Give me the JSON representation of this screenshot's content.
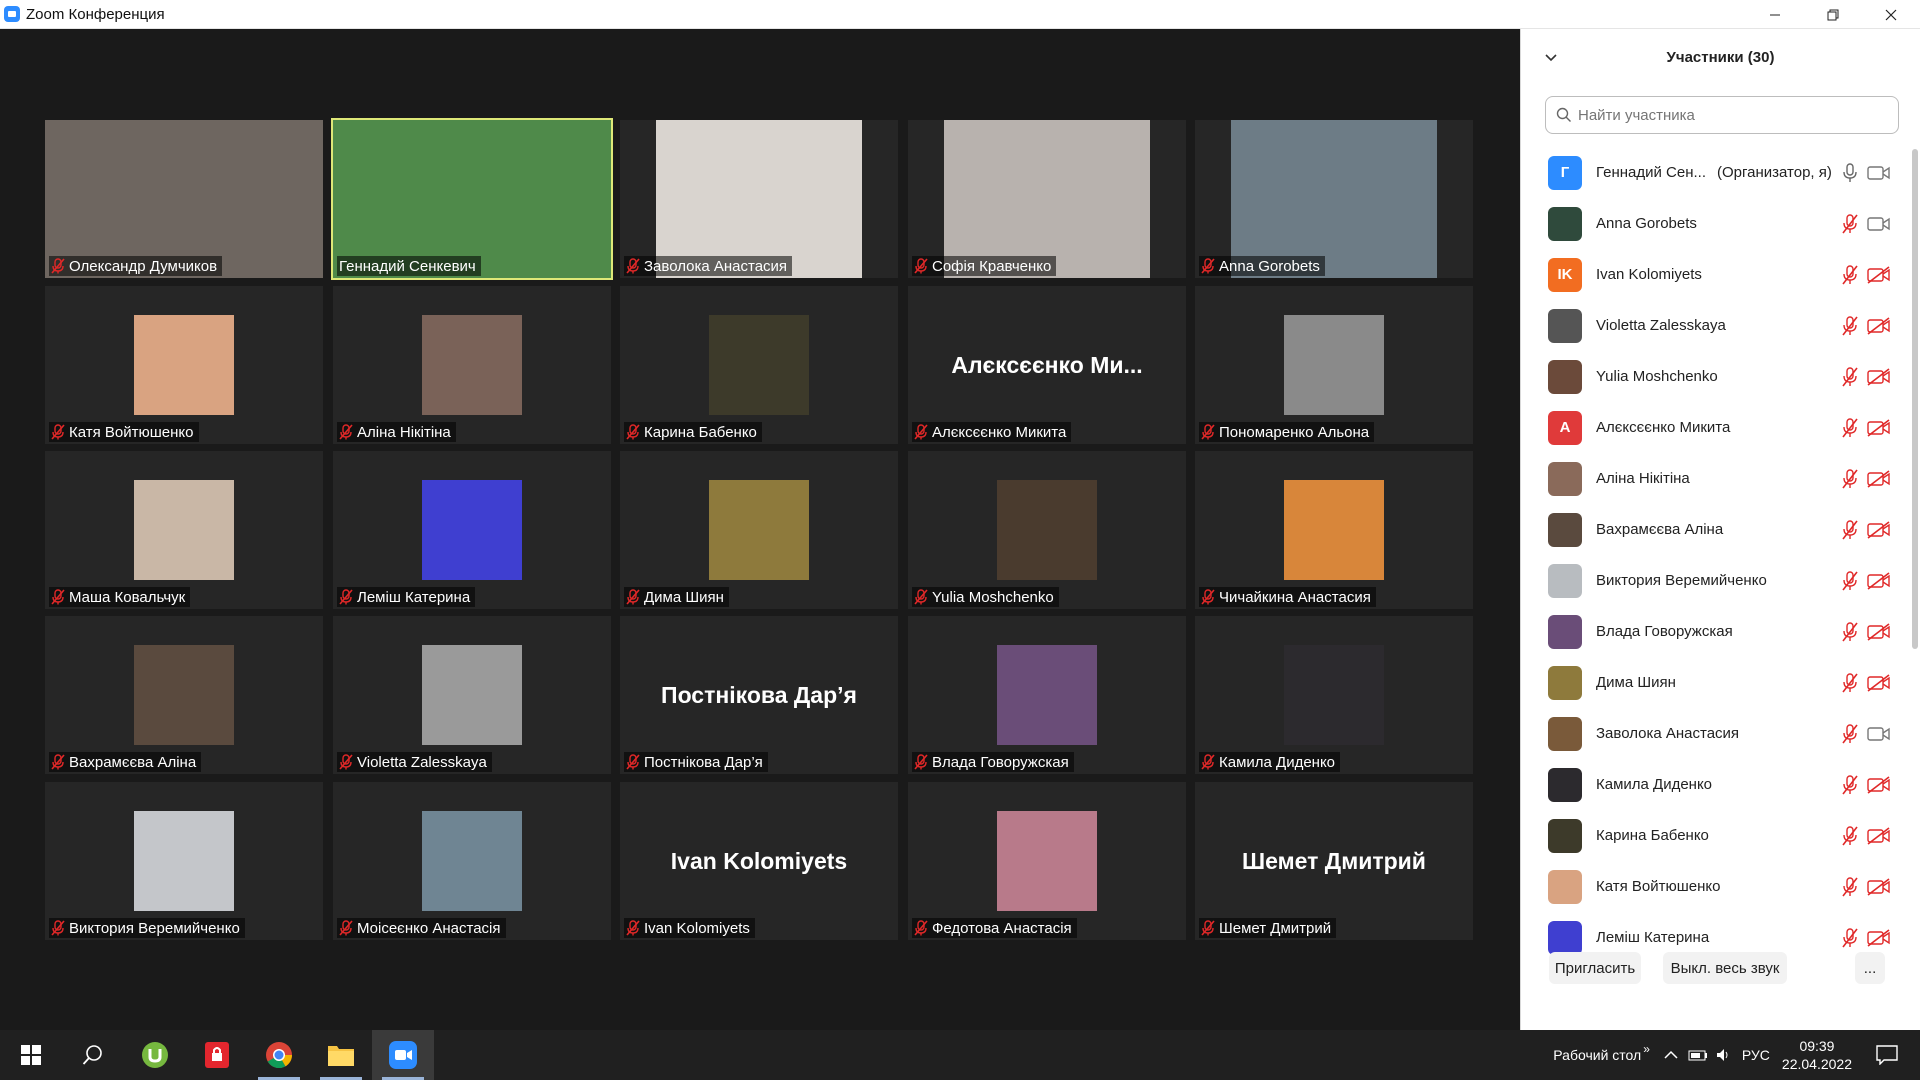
{
  "window": {
    "title": "Zoom Конференция"
  },
  "tiles": [
    {
      "name": "Олександр Думчиков",
      "kind": "cam",
      "bg": "#6e6660",
      "muted": true
    },
    {
      "name": "Геннадий Сенкевич",
      "kind": "cam",
      "bg": "#4f8a4a",
      "muted": false,
      "active": true
    },
    {
      "name": "Заволока Анастасия",
      "kind": "cam",
      "bg": "#d9d4cf",
      "muted": true
    },
    {
      "name": "Софія Кравченко",
      "kind": "cam",
      "bg": "#b8b2ae",
      "muted": true
    },
    {
      "name": "Anna Gorobets",
      "kind": "cam",
      "bg": "#6d7c86",
      "muted": true
    },
    {
      "name": "Катя Войтюшенко",
      "kind": "avatar",
      "bg": "#d9a381",
      "muted": true
    },
    {
      "name": "Аліна Нікітіна",
      "kind": "avatar",
      "bg": "#7a6258",
      "muted": true
    },
    {
      "name": "Карина Бабенко",
      "kind": "avatar",
      "bg": "#3d3a2a",
      "muted": true
    },
    {
      "name": "Алєксєєнко Микита",
      "kind": "text",
      "display": "Алєксєєнко Ми...",
      "muted": true
    },
    {
      "name": "Пономаренко Альона",
      "kind": "avatar",
      "bg": "#8a8a8a",
      "muted": true
    },
    {
      "name": "Маша Ковальчук",
      "kind": "avatar",
      "bg": "#c9b7a6",
      "muted": true
    },
    {
      "name": "Леміш Катерина",
      "kind": "avatar",
      "bg": "#3f3fd0",
      "muted": true
    },
    {
      "name": "Дима Шиян",
      "kind": "avatar",
      "bg": "#8e7a3c",
      "muted": true
    },
    {
      "name": "Yulia Moshchenko",
      "kind": "avatar",
      "bg": "#4a3b2e",
      "muted": true
    },
    {
      "name": "Чичайкина Анастасия",
      "kind": "avatar",
      "bg": "#d8863a",
      "muted": true
    },
    {
      "name": "Вахрамєєва Аліна",
      "kind": "avatar",
      "bg": "#5a4a3e",
      "muted": true
    },
    {
      "name": "Violetta Zalesskaya",
      "kind": "avatar",
      "bg": "#9a9a9a",
      "muted": true
    },
    {
      "name": "Постнікова Дар’я",
      "kind": "text",
      "display": "Постнікова Дар’я",
      "muted": true
    },
    {
      "name": "Влада Говоружская",
      "kind": "avatar",
      "bg": "#6a4d78",
      "muted": true
    },
    {
      "name": "Камила Диденко",
      "kind": "avatar",
      "bg": "#2c2a2e",
      "muted": true
    },
    {
      "name": "Виктория Веремийченко",
      "kind": "avatar",
      "bg": "#c4c6ca",
      "muted": true
    },
    {
      "name": "Моісеєнко Анастасія",
      "kind": "avatar",
      "bg": "#6f8593",
      "muted": true
    },
    {
      "name": "Ivan Kolomiyets",
      "kind": "text",
      "display": "Ivan Kolomiyets",
      "muted": true
    },
    {
      "name": "Федотова Анастасія",
      "kind": "avatar",
      "bg": "#b87a8a",
      "muted": true
    },
    {
      "name": "Шемет Дмитрий",
      "kind": "text",
      "display": "Шемет Дмитрий",
      "muted": true
    }
  ],
  "participants_panel": {
    "title": "Участники (30)",
    "search_placeholder": "Найти участника",
    "participants": [
      {
        "name": "Геннадий Сен...",
        "role": "(Организатор, я)",
        "avatar_letter": "Г",
        "avatar_color": "#2D8CFF",
        "mic": "on",
        "cam": "on"
      },
      {
        "name": "Anna Gorobets",
        "avatar_color": "#2f4a3c",
        "mic": "muted",
        "cam": "on"
      },
      {
        "name": "Ivan Kolomiyets",
        "avatar_letter": "IK",
        "avatar_color": "#f26d21",
        "mic": "muted",
        "cam": "off"
      },
      {
        "name": "Violetta Zalesskaya",
        "avatar_color": "#555555",
        "mic": "muted",
        "cam": "off"
      },
      {
        "name": "Yulia Moshchenko",
        "avatar_color": "#6b4a3a",
        "mic": "muted",
        "cam": "off"
      },
      {
        "name": "Алєксєєнко Микита",
        "avatar_letter": "А",
        "avatar_color": "#e03a3a",
        "mic": "muted",
        "cam": "off"
      },
      {
        "name": "Аліна Нікітіна",
        "avatar_color": "#8a6a5a",
        "mic": "muted",
        "cam": "off"
      },
      {
        "name": "Вахрамєєва Аліна",
        "avatar_color": "#5a4a3e",
        "mic": "muted",
        "cam": "off"
      },
      {
        "name": "Виктория Веремийченко",
        "avatar_color": "#b8bcc0",
        "mic": "muted",
        "cam": "off"
      },
      {
        "name": "Влада Говоружская",
        "avatar_color": "#6a4d78",
        "mic": "muted",
        "cam": "off"
      },
      {
        "name": "Дима Шиян",
        "avatar_color": "#8e7a3c",
        "mic": "muted",
        "cam": "off"
      },
      {
        "name": "Заволока Анастасия",
        "avatar_color": "#7a5a3a",
        "mic": "muted",
        "cam": "on"
      },
      {
        "name": "Камила Диденко",
        "avatar_color": "#2c2a2e",
        "mic": "muted",
        "cam": "off"
      },
      {
        "name": "Карина Бабенко",
        "avatar_color": "#3d3a2a",
        "mic": "muted",
        "cam": "off"
      },
      {
        "name": "Катя Войтюшенко",
        "avatar_color": "#d9a381",
        "mic": "muted",
        "cam": "off"
      },
      {
        "name": "Леміш Катерина",
        "avatar_color": "#3f3fd0",
        "mic": "muted",
        "cam": "off"
      }
    ],
    "invite_label": "Пригласить",
    "mute_all_label": "Выкл. весь звук",
    "more_label": "..."
  },
  "taskbar": {
    "tray_label": "Рабочий стол",
    "chevron": "»",
    "language": "РУС",
    "time": "09:39",
    "date": "22.04.2022"
  }
}
